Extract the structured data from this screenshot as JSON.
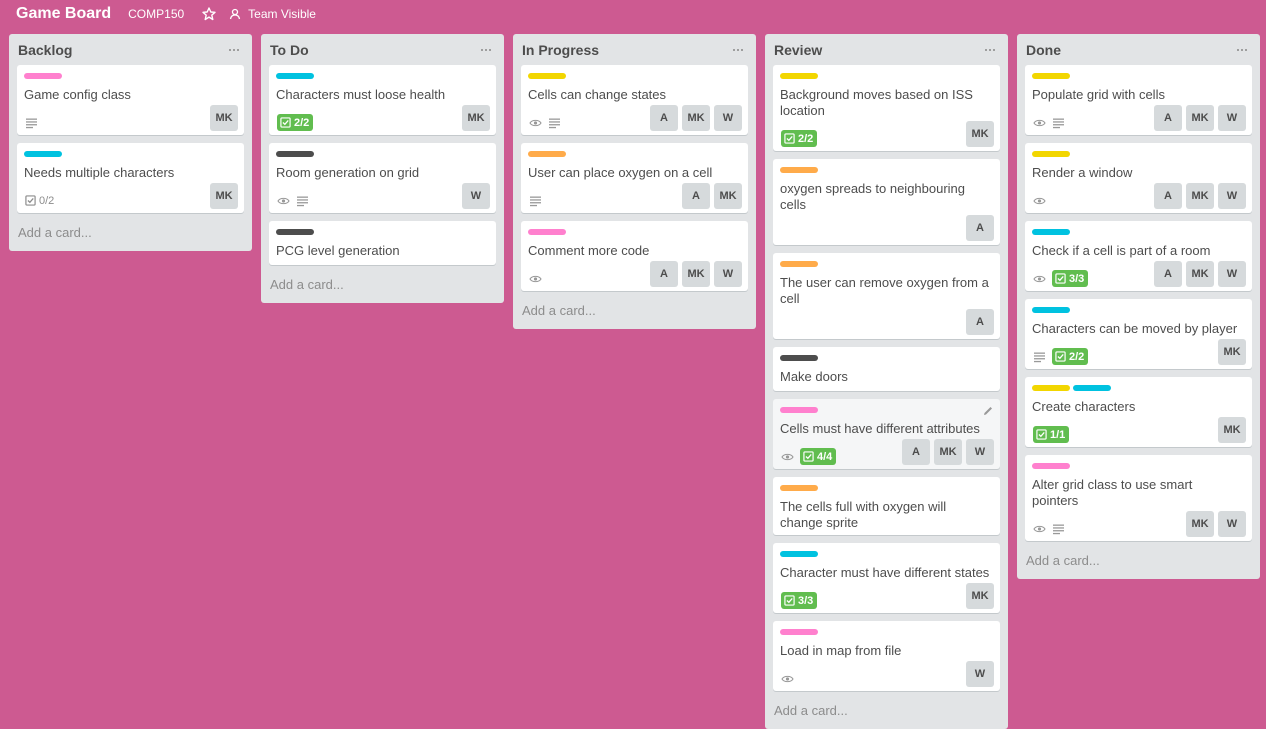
{
  "header": {
    "title": "Game Board",
    "org": "COMP150",
    "visibility": "Team Visible"
  },
  "colors": {
    "background": "#cd5a91",
    "list": "#e2e4e6",
    "label_pink": "#ff80ce",
    "label_cyan": "#00c2e0",
    "label_yellow": "#f2d600",
    "label_orange": "#ffab4a",
    "label_black": "#4d4d4d",
    "complete_green": "#61bd4f"
  },
  "lists": [
    {
      "title": "Backlog",
      "add_label": "Add a card...",
      "cards": [
        {
          "labels": [
            "pink"
          ],
          "title": "Game config class",
          "badges": [
            "description"
          ],
          "checklist": "",
          "members": [
            "MK"
          ]
        },
        {
          "labels": [
            "cyan"
          ],
          "title": "Needs multiple characters",
          "badges": [],
          "checklist": "0/2",
          "checklist_complete": false,
          "members": [
            "MK"
          ]
        }
      ]
    },
    {
      "title": "To Do",
      "add_label": "Add a card...",
      "cards": [
        {
          "labels": [
            "cyan"
          ],
          "title": "Characters must loose health",
          "badges": [],
          "checklist": "2/2",
          "checklist_complete": true,
          "members": [
            "MK"
          ]
        },
        {
          "labels": [
            "black"
          ],
          "title": "Room generation on grid",
          "badges": [
            "watch",
            "description"
          ],
          "checklist": "",
          "members": [
            "W"
          ]
        },
        {
          "labels": [
            "black"
          ],
          "title": "PCG level generation",
          "badges": [],
          "checklist": "",
          "members": []
        }
      ]
    },
    {
      "title": "In Progress",
      "add_label": "Add a card...",
      "cards": [
        {
          "labels": [
            "yellow"
          ],
          "title": "Cells can change states",
          "badges": [
            "watch",
            "description"
          ],
          "checklist": "",
          "members": [
            "A",
            "MK",
            "W"
          ]
        },
        {
          "labels": [
            "orange"
          ],
          "title": "User can place oxygen on a cell",
          "badges": [
            "description"
          ],
          "checklist": "",
          "members": [
            "A",
            "MK"
          ]
        },
        {
          "labels": [
            "pink"
          ],
          "title": "Comment more code",
          "badges": [
            "watch"
          ],
          "checklist": "",
          "members": [
            "A",
            "MK",
            "W"
          ]
        }
      ]
    },
    {
      "title": "Review",
      "add_label": "Add a card...",
      "cards": [
        {
          "labels": [
            "yellow"
          ],
          "title": "Background moves based on ISS location",
          "badges": [],
          "checklist": "2/2",
          "checklist_complete": true,
          "members": [
            "MK"
          ]
        },
        {
          "labels": [
            "orange"
          ],
          "title": "oxygen spreads to neighbouring cells",
          "badges": [],
          "checklist": "",
          "members": [
            "A"
          ]
        },
        {
          "labels": [
            "orange"
          ],
          "title": "The user can remove oxygen from a cell",
          "badges": [],
          "checklist": "",
          "members": [
            "A"
          ]
        },
        {
          "labels": [
            "black"
          ],
          "title": "Make doors",
          "badges": [],
          "checklist": "",
          "members": []
        },
        {
          "labels": [
            "pink"
          ],
          "title": "Cells must have different attributes",
          "badges": [
            "watch"
          ],
          "checklist": "4/4",
          "checklist_complete": true,
          "members": [
            "A",
            "MK",
            "W"
          ],
          "hover": true
        },
        {
          "labels": [
            "orange"
          ],
          "title": "The cells full with oxygen will change sprite",
          "badges": [],
          "checklist": "",
          "members": []
        },
        {
          "labels": [
            "cyan"
          ],
          "title": "Character must have different states",
          "badges": [],
          "checklist": "3/3",
          "checklist_complete": true,
          "members": [
            "MK"
          ]
        },
        {
          "labels": [
            "pink"
          ],
          "title": "Load in map from file",
          "badges": [
            "watch"
          ],
          "checklist": "",
          "members": [
            "W"
          ]
        }
      ]
    },
    {
      "title": "Done",
      "add_label": "Add a card...",
      "cards": [
        {
          "labels": [
            "yellow"
          ],
          "title": "Populate grid with cells",
          "badges": [
            "watch",
            "description"
          ],
          "checklist": "",
          "members": [
            "A",
            "MK",
            "W"
          ]
        },
        {
          "labels": [
            "yellow"
          ],
          "title": "Render a window",
          "badges": [
            "watch"
          ],
          "checklist": "",
          "members": [
            "A",
            "MK",
            "W"
          ]
        },
        {
          "labels": [
            "cyan"
          ],
          "title": "Check if a cell is part of a room",
          "badges": [
            "watch"
          ],
          "checklist": "3/3",
          "checklist_complete": true,
          "members": [
            "A",
            "MK",
            "W"
          ]
        },
        {
          "labels": [
            "cyan"
          ],
          "title": "Characters can be moved by player",
          "badges": [
            "description"
          ],
          "checklist": "2/2",
          "checklist_complete": true,
          "members": [
            "MK"
          ]
        },
        {
          "labels": [
            "yellow",
            "cyan"
          ],
          "title": "Create characters",
          "badges": [],
          "checklist": "1/1",
          "checklist_complete": true,
          "members": [
            "MK"
          ]
        },
        {
          "labels": [
            "pink"
          ],
          "title": "Alter grid class to use smart pointers",
          "badges": [
            "watch",
            "description"
          ],
          "checklist": "",
          "members": [
            "MK",
            "W"
          ]
        }
      ]
    }
  ]
}
